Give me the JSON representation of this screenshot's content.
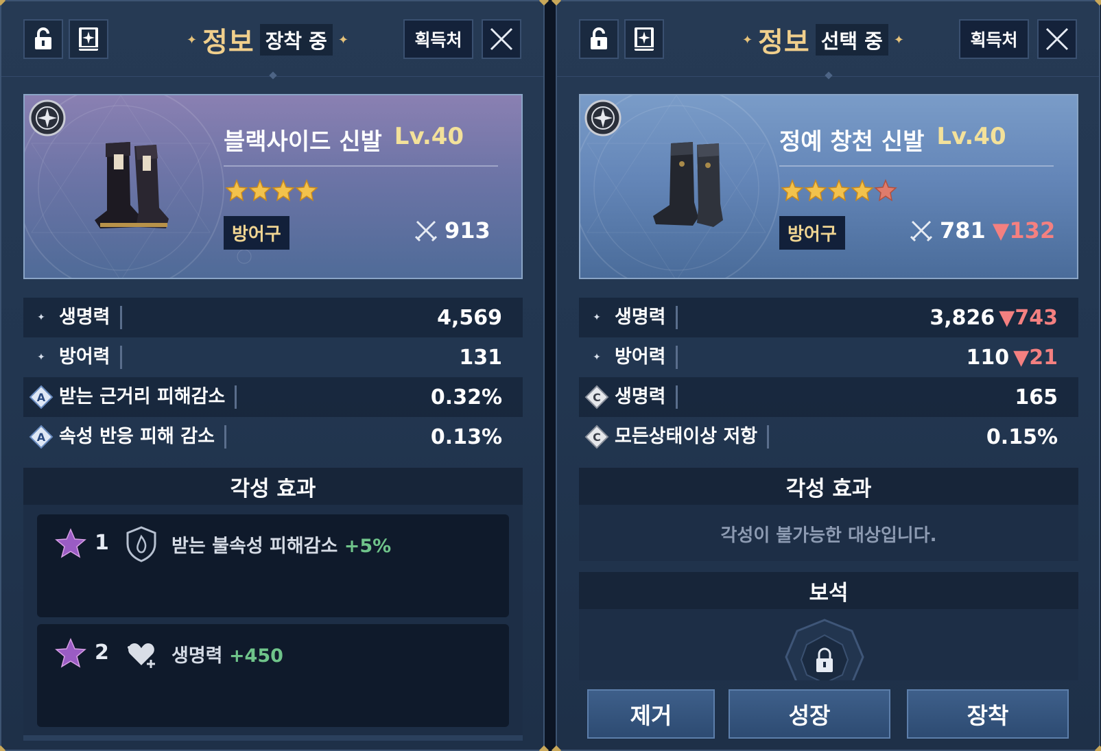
{
  "left": {
    "title": "정보",
    "state": "장착 중",
    "source_label": "획득처",
    "item": {
      "name": "블랙사이드 신발",
      "level": "Lv.40",
      "stars": 4,
      "type": "방어구",
      "power": "913"
    },
    "stats": [
      {
        "marker": "bullet",
        "label": "생명력",
        "value": "4,569"
      },
      {
        "marker": "bullet",
        "label": "방어력",
        "value": "131"
      },
      {
        "marker": "A",
        "label": "받는 근거리 피해감소",
        "value": "0.32%"
      },
      {
        "marker": "A",
        "label": "속성 반응 피해 감소",
        "value": "0.13%"
      }
    ],
    "awakening": {
      "title": "각성 효과",
      "items": [
        {
          "num": "1",
          "text": "받는 불속성 피해감소",
          "plus": "+5%",
          "icon": "fire-shield-icon"
        },
        {
          "num": "2",
          "text": "생명력",
          "plus": "+450",
          "icon": "heart-icon"
        }
      ]
    }
  },
  "right": {
    "title": "정보",
    "state": "선택 중",
    "source_label": "획득처",
    "item": {
      "name": "정예 창천 신발",
      "level": "Lv.40",
      "stars": 4,
      "type": "방어구",
      "power": "781",
      "power_diff": "▼132"
    },
    "stats": [
      {
        "marker": "bullet",
        "label": "생명력",
        "value": "3,826",
        "diff": "▼743"
      },
      {
        "marker": "bullet",
        "label": "방어력",
        "value": "110",
        "diff": "▼21"
      },
      {
        "marker": "C",
        "label": "생명력",
        "value": "165",
        "diff": ""
      },
      {
        "marker": "C",
        "label": "모든상태이상 저항",
        "value": "0.15%",
        "diff": ""
      }
    ],
    "awakening": {
      "title": "각성 효과",
      "empty": "각성이 불가능한 대상입니다."
    },
    "gem": {
      "title": "보석"
    },
    "buttons": {
      "remove": "제거",
      "grow": "성장",
      "equip": "장착"
    }
  },
  "colors": {
    "accent_gold": "#f0cf8c",
    "level_yellow": "#f3e19a",
    "decrease_red": "#f48080",
    "increase_green": "#6fc48a"
  }
}
